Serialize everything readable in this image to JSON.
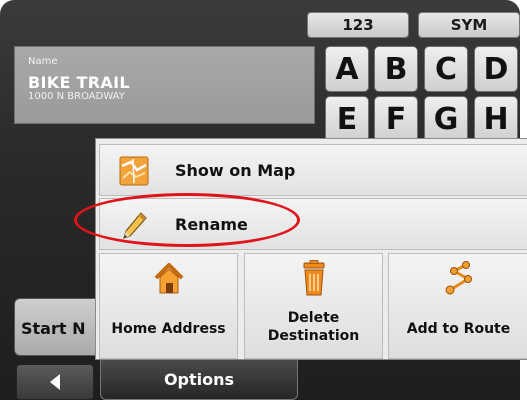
{
  "keyboard": {
    "mode_keys": [
      {
        "label": "123"
      },
      {
        "label": "SYM"
      }
    ],
    "letters": [
      "A",
      "B",
      "C",
      "D",
      "E",
      "F",
      "G",
      "H"
    ]
  },
  "name_panel": {
    "label": "Name",
    "value": "BIKE TRAIL",
    "address": "1000 N BROADWAY"
  },
  "start_button": {
    "label": "Start N"
  },
  "back_button": {
    "icon": "back-arrow-icon"
  },
  "options_menu": {
    "rows": [
      {
        "label": "Show on Map",
        "icon": "map-icon"
      },
      {
        "label": "Rename",
        "icon": "pencil-icon"
      }
    ],
    "tiles": [
      {
        "label": "Home Address",
        "icon": "home-icon"
      },
      {
        "label_line1": "Delete",
        "label_line2": "Destination",
        "icon": "trash-icon"
      },
      {
        "label": "Add to Route",
        "icon": "route-icon"
      }
    ],
    "tab_label": "Options"
  },
  "colors": {
    "highlight": "#e0141b",
    "map_orange": "#f2a33a",
    "home_orange": "#f5a030",
    "trash_orange": "#f08a1c"
  }
}
